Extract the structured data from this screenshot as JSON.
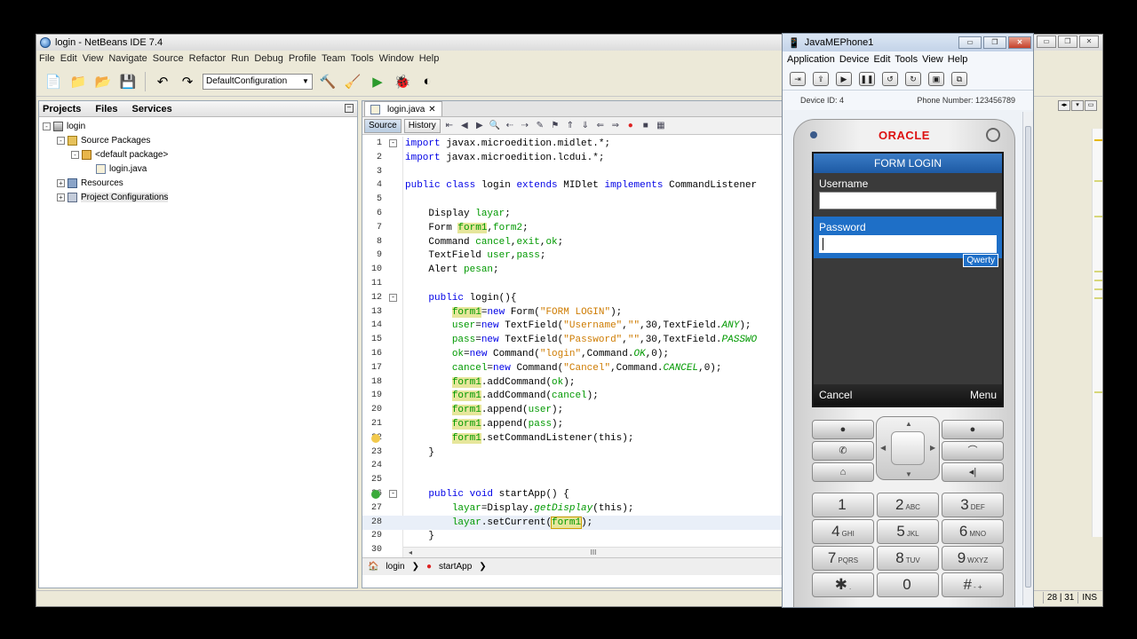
{
  "ide": {
    "title": "login - NetBeans IDE 7.4",
    "menu": [
      "File",
      "Edit",
      "View",
      "Navigate",
      "Source",
      "Refactor",
      "Run",
      "Debug",
      "Profile",
      "Team",
      "Tools",
      "Window",
      "Help"
    ],
    "config": "DefaultConfiguration"
  },
  "projects_panel": {
    "tabs": [
      "Projects",
      "Files",
      "Services"
    ],
    "tree": [
      {
        "label": "login",
        "icon": "project-icon",
        "indent": 0,
        "toggle": "-"
      },
      {
        "label": "Source Packages",
        "icon": "folder-icon",
        "indent": 1,
        "toggle": "-"
      },
      {
        "label": "<default package>",
        "icon": "package-icon",
        "indent": 2,
        "toggle": "-"
      },
      {
        "label": "login.java",
        "icon": "java-file-icon",
        "indent": 3,
        "toggle": ""
      },
      {
        "label": "Resources",
        "icon": "resources-icon",
        "indent": 1,
        "toggle": "+"
      },
      {
        "label": "Project Configurations",
        "icon": "config-icon",
        "indent": 1,
        "toggle": "+"
      }
    ]
  },
  "editor": {
    "tab": "login.java",
    "source_btn": "Source",
    "history_btn": "History",
    "lines": [
      "import javax.microedition.midlet.*;",
      "import javax.microedition.lcdui.*;",
      "",
      "public class login extends MIDlet implements CommandListener",
      "",
      "    Display layar;",
      "    Form form1,form2;",
      "    Command cancel,exit,ok;",
      "    TextField user,pass;",
      "    Alert pesan;",
      "",
      "    public login(){",
      "        form1=new Form(\"FORM LOGIN\");",
      "        user=new TextField(\"Username\",\"\",30,TextField.ANY);",
      "        pass=new TextField(\"Password\",\"\",30,TextField.PASSWO",
      "        ok=new Command(\"login\",Command.OK,0);",
      "        cancel=new Command(\"Cancel\",Command.CANCEL,0);",
      "        form1.addCommand(ok);",
      "        form1.addCommand(cancel);",
      "        form1.append(user);",
      "        form1.append(pass);",
      "        form1.setCommandListener(this);",
      "    }",
      "",
      "",
      "    public void startApp() {",
      "        layar=Display.getDisplay(this);",
      "        layar.setCurrent(form1);",
      "    }",
      ""
    ],
    "line_numbers": [
      "1",
      "2",
      "3",
      "4",
      "5",
      "6",
      "7",
      "8",
      "9",
      "10",
      "11",
      "12",
      "13",
      "14",
      "15",
      "16",
      "17",
      "18",
      "19",
      "20",
      "21",
      "22",
      "23",
      "24",
      "25",
      "26",
      "27",
      "28",
      "29",
      "30"
    ],
    "breadcrumb": [
      "login",
      "startApp"
    ],
    "hscroll_label": "III"
  },
  "status": {
    "position": "28 | 31",
    "mode": "INS"
  },
  "phone": {
    "title": "JavaMEPhone1",
    "menu": [
      "Application",
      "Device",
      "Edit",
      "Tools",
      "View",
      "Help"
    ],
    "device_id": "Device ID: 4",
    "phone_number": "Phone Number: 123456789",
    "brand": "ORACLE",
    "screen": {
      "form_title": "FORM LOGIN",
      "username_label": "Username",
      "password_label": "Password",
      "input_mode": "Qwerty",
      "softkey_left": "Cancel",
      "softkey_right": "Menu"
    },
    "keys": [
      {
        "n": "1",
        "l": ""
      },
      {
        "n": "2",
        "l": "ABC"
      },
      {
        "n": "3",
        "l": "DEF"
      },
      {
        "n": "4",
        "l": "GHI"
      },
      {
        "n": "5",
        "l": "JKL"
      },
      {
        "n": "6",
        "l": "MNO"
      },
      {
        "n": "7",
        "l": "PQRS"
      },
      {
        "n": "8",
        "l": "TUV"
      },
      {
        "n": "9",
        "l": "WXYZ"
      },
      {
        "n": "✱",
        "l": "."
      },
      {
        "n": "0",
        "l": ""
      },
      {
        "n": "#",
        "l": "- +"
      }
    ]
  },
  "colors": {
    "keyword": "#0000e6",
    "field": "#009900",
    "string": "#ce7b00",
    "form_title_bg": "#1d5aa4",
    "brand": "#dd1111"
  }
}
